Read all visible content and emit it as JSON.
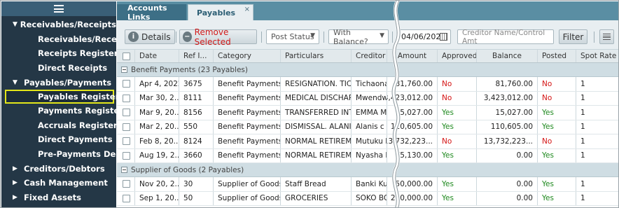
{
  "sidebar": {
    "items": [
      {
        "label": "Receivables/Receipts",
        "type": "group"
      },
      {
        "label": "Receivables/Receipts",
        "type": "sub"
      },
      {
        "label": "Receipts Register",
        "type": "sub"
      },
      {
        "label": "Direct Receipts",
        "type": "sub"
      },
      {
        "label": "Payables/Payments",
        "type": "group"
      },
      {
        "label": "Payables Register",
        "type": "sub",
        "active": true
      },
      {
        "label": "Payments Register",
        "type": "sub"
      },
      {
        "label": "Accruals Register",
        "type": "sub"
      },
      {
        "label": "Direct Payments",
        "type": "sub"
      },
      {
        "label": "Pre-Payments Deduct",
        "type": "sub"
      },
      {
        "label": "Creditors/Debtors",
        "type": "collapsed"
      },
      {
        "label": "Cash Management",
        "type": "collapsed"
      },
      {
        "label": "Fixed Assets",
        "type": "collapsed"
      }
    ]
  },
  "tabs": {
    "accounts_links": "Accounts Links",
    "payables": "Payables",
    "close_glyph": "×"
  },
  "toolbar": {
    "details_label": "Details",
    "details_icon": "i",
    "remove_label": "Remove Selected",
    "remove_icon": "−",
    "post_status": "Post Status",
    "with_balance": "With Balance?",
    "date": "04/06/2022",
    "creditor_placeholder": "Creditor Name/Control Amt",
    "filter_label": "Filter"
  },
  "grid": {
    "columns": [
      "Date",
      "Ref I...",
      "Category",
      "Particulars",
      "Creditor",
      "Amount",
      "Approved",
      "Balance",
      "Posted",
      "Spot Rate"
    ],
    "groups": [
      {
        "label": "Benefit Payments (23 Payables)",
        "rows": [
          {
            "date": "Apr 4, 2022",
            "ref": "3675",
            "category": "Benefit Payments",
            "particulars": "RESIGNATION. TIC...",
            "creditor": "Tichaona P",
            "amount": "81,760.00",
            "approved": "No",
            "balance": "81,760.00",
            "posted": "No",
            "spot": "1"
          },
          {
            "date": "Mar 30, 2...",
            "ref": "8111",
            "category": "Benefit Payments",
            "particulars": "MEDICAL DISCHAR...",
            "creditor": "Mwendwa R",
            "amount": "3,423,012.00",
            "approved": "No",
            "balance": "3,423,012.00",
            "posted": "No",
            "spot": "1"
          },
          {
            "date": "Mar 9, 20...",
            "ref": "8156",
            "category": "Benefit Payments",
            "particulars": "TRANSFERRED INT...",
            "creditor": "EMMA MUKU",
            "amount": "15,027.00",
            "approved": "Yes",
            "balance": "15,027.00",
            "posted": "Yes",
            "spot": "1"
          },
          {
            "date": "Mar 2, 20...",
            "ref": "550",
            "category": "Benefit Payments",
            "particulars": "DISMISSAL. ALANIS...",
            "creditor": "Alanis c Smith",
            "amount": "110,605.00",
            "approved": "Yes",
            "balance": "110,605.00",
            "posted": "Yes",
            "spot": "1"
          },
          {
            "date": "Feb 8, 20...",
            "ref": "8124",
            "category": "Benefit Payments",
            "particulars": "NORMAL RETIREM...",
            "creditor": "Mutuku M",
            "amount": "13,732,223...",
            "approved": "No",
            "balance": "13,732,223...",
            "posted": "No",
            "spot": "1"
          },
          {
            "date": "Aug 19, 2...",
            "ref": "3660",
            "category": "Benefit Payments",
            "particulars": "NORMAL RETIREM...",
            "creditor": "Nyasha Hedr",
            "amount": "75,130.00",
            "approved": "Yes",
            "balance": "0.00",
            "posted": "Yes",
            "spot": "1"
          }
        ]
      },
      {
        "label": "Supplier of Goods (2 Payables)",
        "rows": [
          {
            "date": "Nov 20, 2...",
            "ref": "30",
            "category": "Supplier of Goods",
            "particulars": "Staff Bread",
            "creditor": "Banki Kuu S",
            "amount": "50,000.00",
            "approved": "Yes",
            "balance": "0.00",
            "posted": "Yes",
            "spot": "1"
          },
          {
            "date": "Sep 1, 20...",
            "ref": "50",
            "category": "Supplier of Goods",
            "particulars": "GROCERIES",
            "creditor": "SOKO BOR",
            "amount": "200,000.00",
            "approved": "Yes",
            "balance": "0.00",
            "posted": "Yes",
            "spot": "1"
          }
        ]
      }
    ]
  },
  "colors": {
    "sidebar_bg": "#243746",
    "tabstrip_bg": "#5a8ea3",
    "highlight_border": "#e3e61a",
    "no_red": "#d41414",
    "yes_green": "#1f8a1f"
  }
}
